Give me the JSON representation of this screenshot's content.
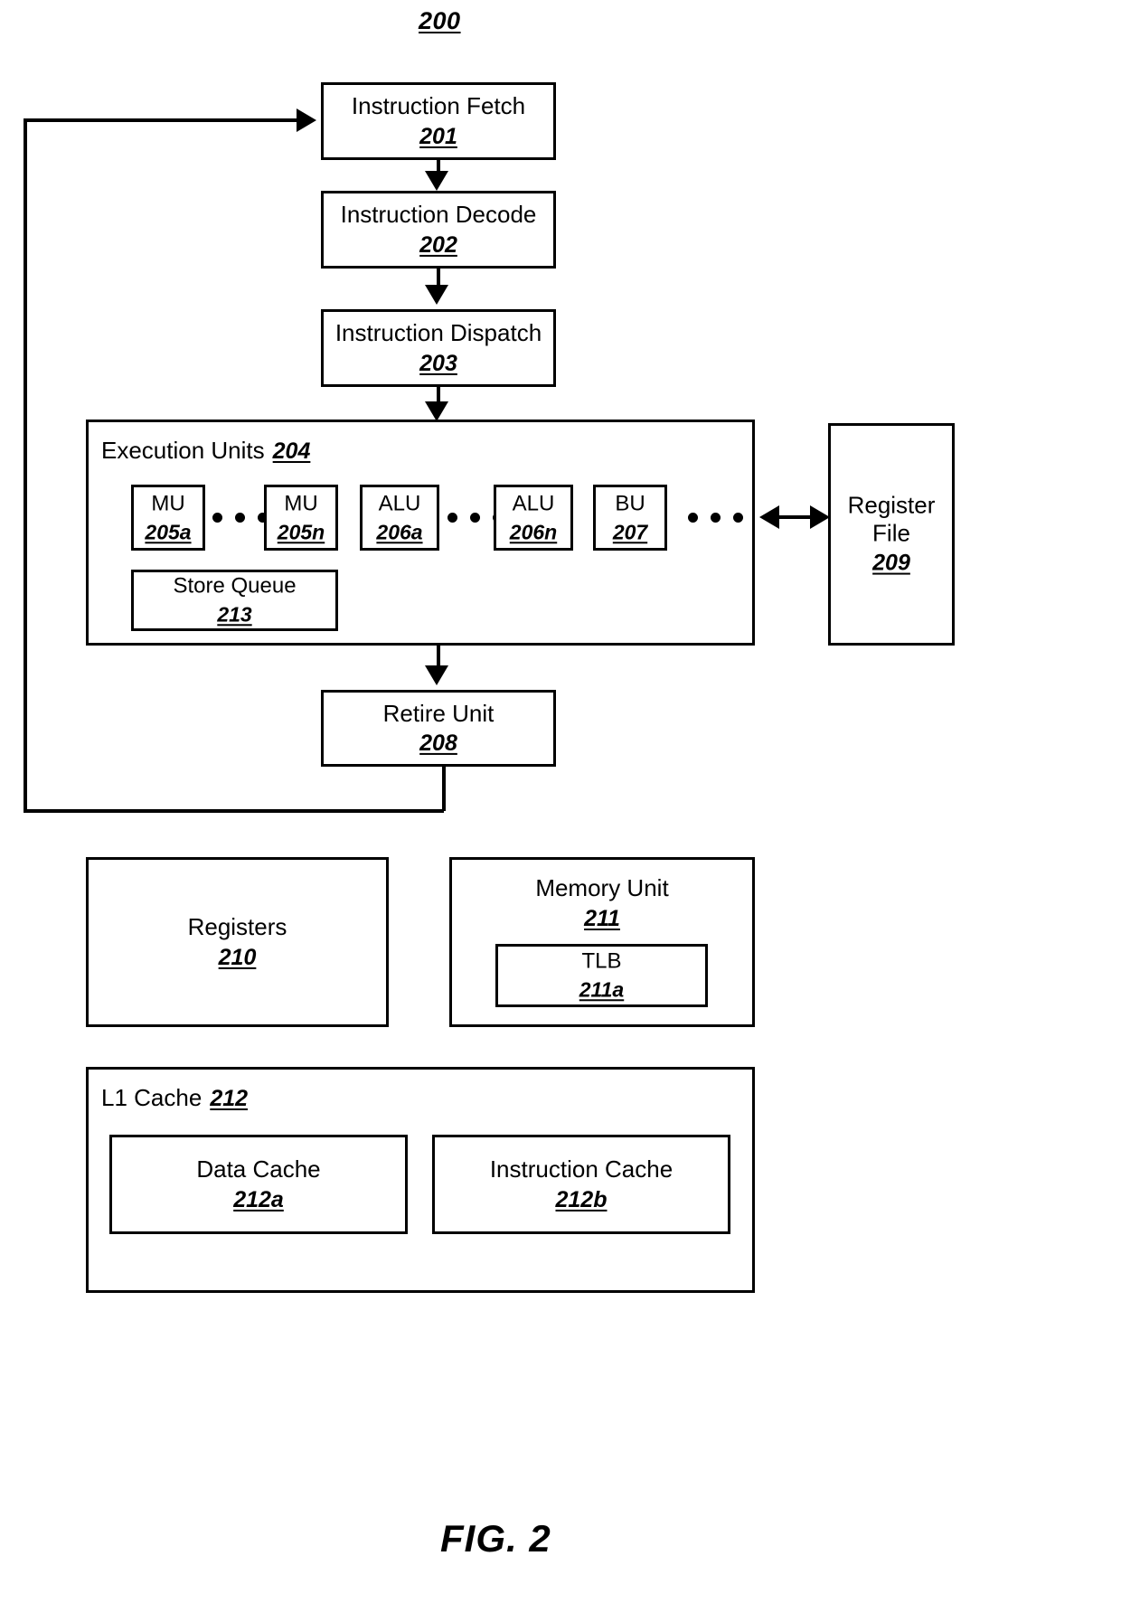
{
  "figure": {
    "number": "200",
    "caption": "FIG. 2"
  },
  "nodes": {
    "instruction_fetch": {
      "title": "Instruction Fetch",
      "ref": "201"
    },
    "instruction_decode": {
      "title": "Instruction Decode",
      "ref": "202"
    },
    "instruction_dispatch": {
      "title": "Instruction Dispatch",
      "ref": "203"
    },
    "execution_units": {
      "title": "Execution Units",
      "ref": "204"
    },
    "mu_a": {
      "title": "MU",
      "ref": "205a"
    },
    "mu_n": {
      "title": "MU",
      "ref": "205n"
    },
    "alu_a": {
      "title": "ALU",
      "ref": "206a"
    },
    "alu_n": {
      "title": "ALU",
      "ref": "206n"
    },
    "bu": {
      "title": "BU",
      "ref": "207"
    },
    "store_queue": {
      "title": "Store Queue",
      "ref": "213"
    },
    "register_file": {
      "title_line1": "Register",
      "title_line2": "File",
      "ref": "209"
    },
    "retire_unit": {
      "title": "Retire Unit",
      "ref": "208"
    },
    "registers": {
      "title": "Registers",
      "ref": "210"
    },
    "memory_unit": {
      "title": "Memory Unit",
      "ref": "211"
    },
    "tlb": {
      "title": "TLB",
      "ref": "211a"
    },
    "l1_cache": {
      "title": "L1 Cache",
      "ref": "212"
    },
    "data_cache": {
      "title": "Data Cache",
      "ref": "212a"
    },
    "instruction_cache": {
      "title": "Instruction Cache",
      "ref": "212b"
    }
  },
  "colors": {
    "stroke": "#000000",
    "background": "#ffffff"
  }
}
